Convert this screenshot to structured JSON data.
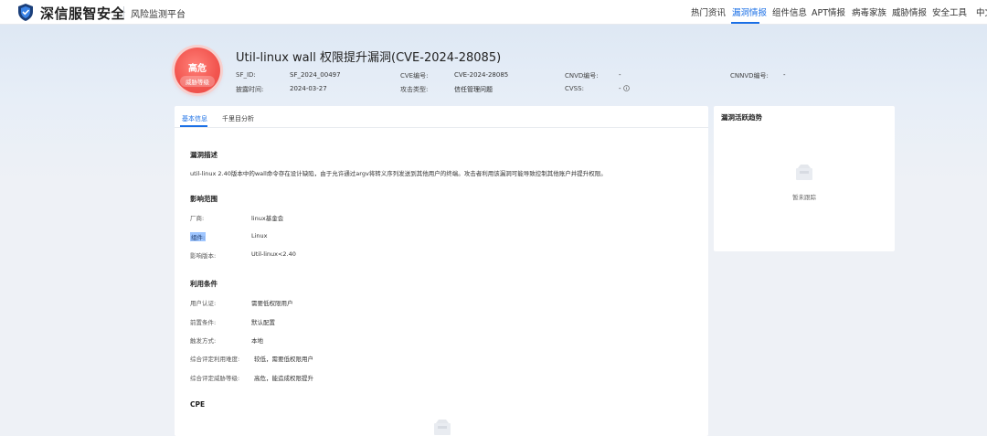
{
  "brand": {
    "name": "深信服智安全",
    "subtitle": "风险监测平台"
  },
  "nav": [
    {
      "label": "热门资讯",
      "active": false
    },
    {
      "label": "漏洞情报",
      "active": true
    },
    {
      "label": "组件信息",
      "active": false
    },
    {
      "label": "APT情报",
      "active": false
    },
    {
      "label": "病毒家族",
      "active": false
    },
    {
      "label": "威胁情报",
      "active": false
    },
    {
      "label": "安全工具",
      "active": false
    },
    {
      "label": "中文",
      "active": false
    }
  ],
  "header": {
    "badge_level": "高危",
    "badge_sub": "威胁等级",
    "title": "Util-linux wall 权限提升漏洞(CVE-2024-28085)",
    "meta": {
      "sf_id_label": "SF_ID:",
      "sf_id": "SF_2024_00497",
      "cve_label": "CVE编号:",
      "cve": "CVE-2024-28085",
      "cnvd_label": "CNVD编号:",
      "cnvd": "-",
      "cnnvd_label": "CNNVD编号:",
      "cnnvd": "-",
      "disclose_label": "披露时间:",
      "disclose": "2024-03-27",
      "attack_label": "攻击类型:",
      "attack": "信任管理问题",
      "cvss_label": "CVSS:",
      "cvss": "-"
    }
  },
  "tabs": [
    {
      "label": "基本信息",
      "active": true
    },
    {
      "label": "千里目分析",
      "active": false
    }
  ],
  "sections": {
    "desc_title": "漏洞描述",
    "desc_text": "util-linux 2.40版本中的wall命令存在设计缺陷，由于允许通过argv将转义序列发送到其他用户的终端。攻击者利用该漏洞可能导致控制其他账户并提升权限。",
    "scope_title": "影响范围",
    "scope": [
      {
        "label": "厂商:",
        "value": "linux基金会"
      },
      {
        "label": "组件:",
        "value": "Linux"
      },
      {
        "label": "影响版本:",
        "value": "Util-linux<2.40"
      }
    ],
    "cond_title": "利用条件",
    "conditions": [
      {
        "label": "用户认证:",
        "value": "需要低权限用户"
      },
      {
        "label": "前置条件:",
        "value": "默认配置"
      },
      {
        "label": "触发方式:",
        "value": "本地"
      },
      {
        "label": "综合评定利用难度:",
        "value": "较低，需要低权限用户"
      },
      {
        "label": "综合评定威胁等级:",
        "value": "高危，能造成权限提升"
      }
    ],
    "cpe_title": "CPE"
  },
  "side": {
    "title": "漏洞活跃趋势",
    "empty_text": "暂未跟踪"
  },
  "colors": {
    "accent": "#1a6fe6",
    "danger": "#f2554f"
  },
  "icons": {
    "logo": "shield-logo-icon",
    "info": "info-circle-icon",
    "empty": "empty-box-icon"
  }
}
